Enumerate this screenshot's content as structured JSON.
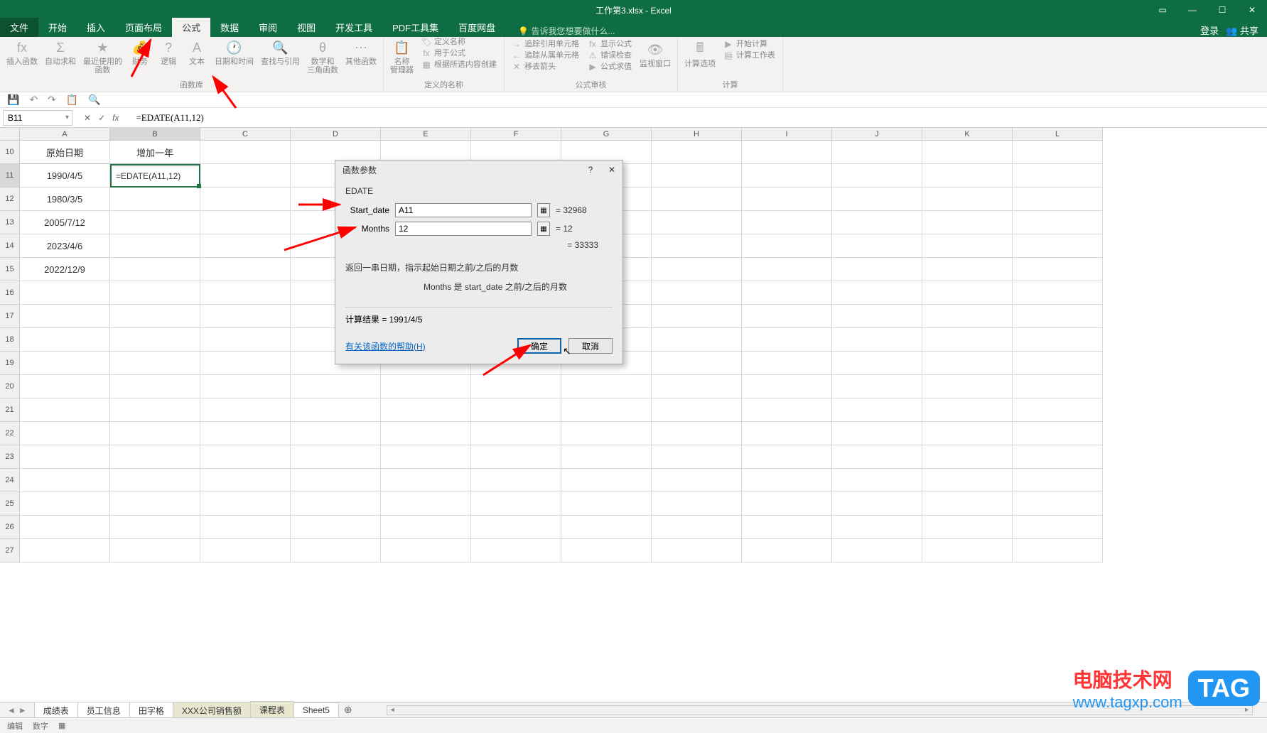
{
  "titlebar": {
    "center": "工作第3.xlsx - Excel"
  },
  "tabs": {
    "file": "文件",
    "items": [
      "开始",
      "插入",
      "页面布局",
      "公式",
      "数据",
      "审阅",
      "视图",
      "开发工具",
      "PDF工具集",
      "百度网盘"
    ],
    "active": "公式",
    "tell_placeholder": "告诉我您想要做什么...",
    "login": "登录",
    "share": "共享"
  },
  "ribbon": {
    "g1": {
      "insert_fn": "插入函数",
      "autosum": "自动求和",
      "recent": "最近使用的\n函数",
      "financial": "财务",
      "logical": "逻辑",
      "text": "文本",
      "datetime": "日期和时间",
      "lookup": "查找与引用",
      "math": "数学和\n三角函数",
      "more": "其他函数",
      "label": "函数库"
    },
    "g2": {
      "name_mgr": "名称\n管理器",
      "define": "定义名称",
      "use_in": "用于公式",
      "create_from": "根据所选内容创建",
      "label": "定义的名称"
    },
    "g3": {
      "trace_prec": "追踪引用单元格",
      "trace_dep": "追踪从属单元格",
      "remove_arrows": "移去箭头",
      "show_formulas": "显示公式",
      "error_check": "错误检查",
      "eval": "公式求值",
      "watch": "监视窗口",
      "label": "公式审核"
    },
    "g4": {
      "calc_options": "计算选项",
      "calc_now": "开始计算",
      "calc_sheet": "计算工作表",
      "label": "计算"
    }
  },
  "qa": {
    "save": "💾",
    "undo": "↶",
    "redo": "↷"
  },
  "formula_bar": {
    "name": "B11",
    "formula": "=EDATE(A11,12)"
  },
  "columns": [
    "A",
    "B",
    "C",
    "D",
    "E",
    "F",
    "G",
    "H",
    "I",
    "J",
    "K",
    "L"
  ],
  "rows": [
    10,
    11,
    12,
    13,
    14,
    15,
    16,
    17,
    18,
    19,
    20,
    21,
    22,
    23,
    24,
    25,
    26,
    27
  ],
  "cells": {
    "headers": {
      "A": "原始日期",
      "B": "增加一年"
    },
    "data": [
      {
        "A": "1990/4/5",
        "B": "=EDATE(A11,12)"
      },
      {
        "A": "1980/3/5",
        "B": ""
      },
      {
        "A": "2005/7/12",
        "B": ""
      },
      {
        "A": "2023/4/6",
        "B": ""
      },
      {
        "A": "2022/12/9",
        "B": ""
      }
    ]
  },
  "dialog": {
    "title": "函数参数",
    "func": "EDATE",
    "arg1_label": "Start_date",
    "arg1_value": "A11",
    "arg1_result": "= 32968",
    "arg2_label": "Months",
    "arg2_value": "12",
    "arg2_result": "= 12",
    "preview": "= 33333",
    "desc": "返回一串日期，指示起始日期之前/之后的月数",
    "desc2": "Months  是 start_date 之前/之后的月数",
    "result_label": "计算结果 = 1991/4/5",
    "help": "有关该函数的帮助(H)",
    "ok": "确定",
    "cancel": "取消"
  },
  "sheets": {
    "tabs": [
      "成绩表",
      "员工信息",
      "田字格",
      "XXX公司销售额",
      "课程表",
      "Sheet5"
    ],
    "active": "课程表"
  },
  "status": {
    "mode": "编辑",
    "num": "数字"
  },
  "watermark": {
    "t1": "电脑技术网",
    "t2": "www.tagxp.com",
    "tag": "TAG"
  }
}
